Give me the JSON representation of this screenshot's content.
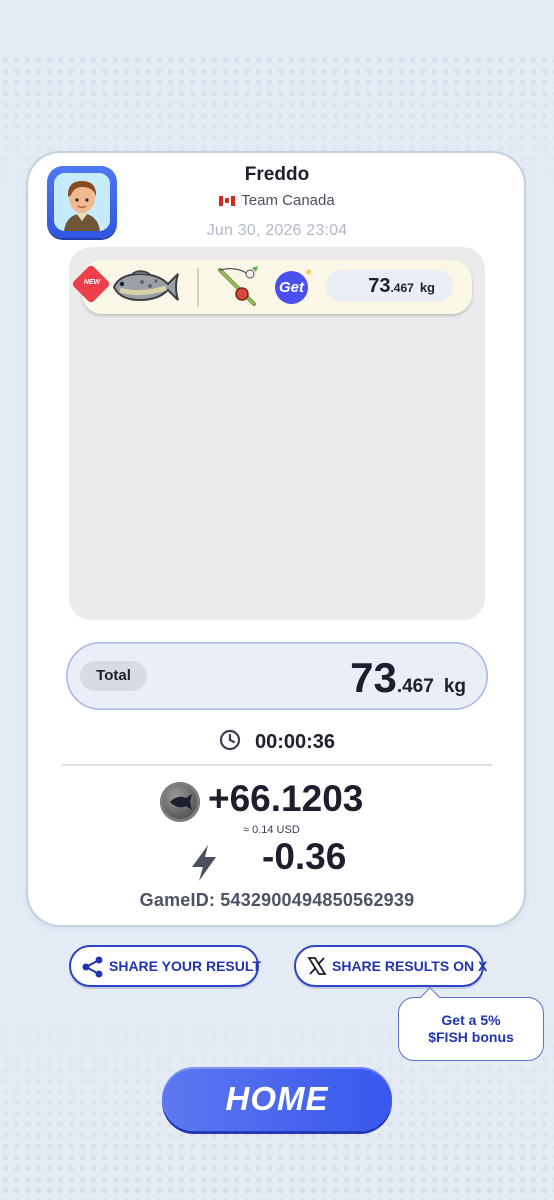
{
  "player": {
    "name": "Freddo",
    "team": "Team Canada",
    "timestamp": "Jun 30, 2026 23:04"
  },
  "catch": {
    "new_badge": "NEW",
    "get_badge": "Get",
    "weight_int": "73",
    "weight_dec": ".467",
    "unit": "kg",
    "icons": [
      "fish-icon",
      "fishing-rod-icon"
    ]
  },
  "total": {
    "label": "Total",
    "weight_int": "73",
    "weight_dec": ".467",
    "unit": "kg"
  },
  "timer": {
    "value": "00:00:36"
  },
  "rewards": {
    "fish_amount": "+66.1203",
    "usd_equivalent": "≈ 0.14 USD",
    "energy": "-0.36"
  },
  "game": {
    "id_text": "GameID: 5432900494850562939"
  },
  "actions": {
    "share_result": "SHARE YOUR RESULT",
    "share_x": "SHARE RESULTS ON X",
    "tooltip_line1": "Get a 5%",
    "tooltip_line2": "$FISH bonus",
    "home": "HOME"
  },
  "colors": {
    "accent": "#3857ee",
    "button_text": "#2135b0",
    "new_badge": "#ec3f4b",
    "background": "#e4ebf5"
  }
}
